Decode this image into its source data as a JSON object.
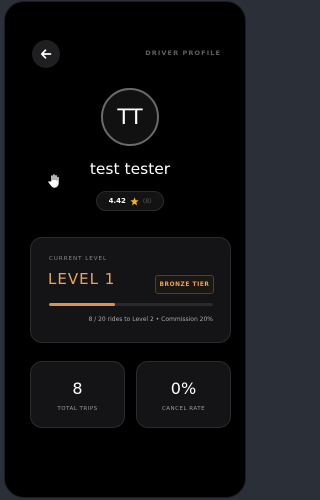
{
  "header": {
    "title": "DRIVER PROFILE",
    "back_icon": "arrow-left-icon"
  },
  "profile": {
    "initials": "TT",
    "name": "test tester",
    "rating": "4.42",
    "rating_icon": "star-icon",
    "rating_count": "(8)"
  },
  "level": {
    "eyebrow": "CURRENT LEVEL",
    "value": "LEVEL 1",
    "tier": "BRONZE TIER",
    "progress": 0.4,
    "note": "8 / 20 rides to Level 2 • Commission 20%"
  },
  "stats": [
    {
      "value": "8",
      "label": "TOTAL TRIPS"
    },
    {
      "value": "0%",
      "label": "CANCEL RATE"
    }
  ],
  "colors": {
    "accent": "#e8a55e",
    "background": "#000000",
    "card": "#141416",
    "star": "#f2b21b"
  }
}
